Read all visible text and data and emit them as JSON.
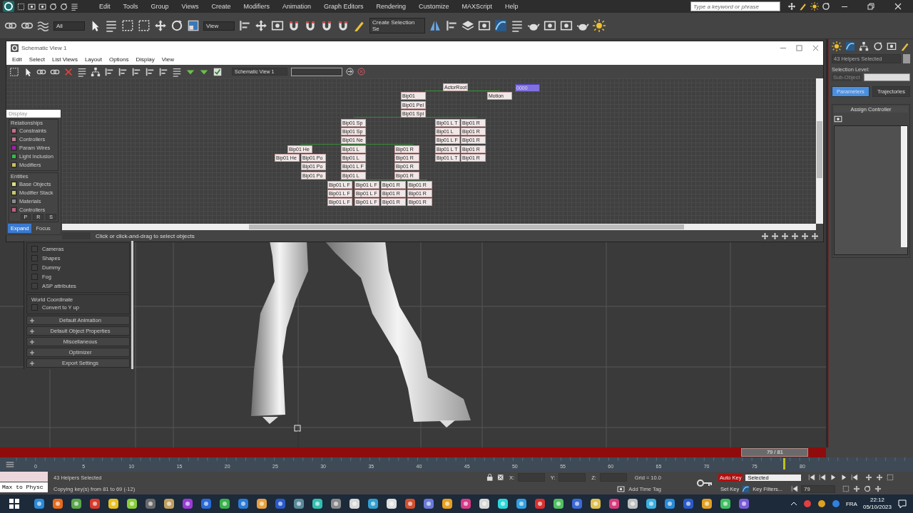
{
  "menu": [
    "Edit",
    "Tools",
    "Group",
    "Views",
    "Create",
    "Modifiers",
    "Animation",
    "Graph Editors",
    "Rendering",
    "Customize",
    "MAXScript",
    "Help"
  ],
  "search": {
    "placeholder": "Type a keyword or phrase"
  },
  "toolbar": {
    "selection_filter": "All",
    "reference_coord": "View",
    "named_selection": "Create Selection Se"
  },
  "schematic": {
    "title": "Schematic View 1",
    "menu": [
      "Edit",
      "Select",
      "List Views",
      "Layout",
      "Options",
      "Display",
      "View"
    ],
    "view_name": "Schematic View 1",
    "status": "Click or click-and-drag to select objects",
    "nodes": [
      {
        "label": "ActorRoot",
        "selected": false
      },
      {
        "label": "0000",
        "selected": true
      },
      {
        "label": "Bip01",
        "selected": false
      },
      {
        "label": "Motion",
        "selected": false
      },
      {
        "label": "Bip01 Pel",
        "selected": false
      },
      {
        "label": "Bip01 Spi",
        "selected": false
      },
      {
        "label": "Bip01 Sp",
        "selected": false
      },
      {
        "label": "Bip01 L T",
        "selected": false
      },
      {
        "label": "Bip01 R",
        "selected": false
      },
      {
        "label": "Bip01 Sp",
        "selected": false
      },
      {
        "label": "Bip01 L",
        "selected": false
      },
      {
        "label": "Bip01 R",
        "selected": false
      },
      {
        "label": "Bip01 Ne",
        "selected": false
      },
      {
        "label": "Bip01 L F",
        "selected": false
      },
      {
        "label": "Bip01 R",
        "selected": false
      },
      {
        "label": "Bip01 He",
        "selected": false
      },
      {
        "label": "Bip01 L",
        "selected": false
      },
      {
        "label": "Bip01 R",
        "selected": false
      },
      {
        "label": "Bip01 L T",
        "selected": false
      },
      {
        "label": "Bip01 R",
        "selected": false
      },
      {
        "label": "Bip01 He",
        "selected": false
      },
      {
        "label": "Bip01 Po",
        "selected": false
      },
      {
        "label": "Bip01 L",
        "selected": false
      },
      {
        "label": "Bip01 R",
        "selected": false
      },
      {
        "label": "Bip01 L T",
        "selected": false
      },
      {
        "label": "Bip01 R",
        "selected": false
      },
      {
        "label": "Bip01 Po",
        "selected": false
      },
      {
        "label": "Bip01 L F",
        "selected": false
      },
      {
        "label": "Bip01 R",
        "selected": false
      },
      {
        "label": "Bip01 Po",
        "selected": false
      },
      {
        "label": "Bip01 L",
        "selected": false
      },
      {
        "label": "Bip01 R",
        "selected": false
      },
      {
        "label": "Bip01 L F",
        "selected": false
      },
      {
        "label": "Bip01 L F",
        "selected": false
      },
      {
        "label": "Bip01 R",
        "selected": false
      },
      {
        "label": "Bip01 R",
        "selected": false
      },
      {
        "label": "Bip01 L F",
        "selected": false
      },
      {
        "label": "Bip01 L F",
        "selected": false
      },
      {
        "label": "Bip01 R",
        "selected": false
      },
      {
        "label": "Bip01 R",
        "selected": false
      },
      {
        "label": "Bip01 L F",
        "selected": false
      },
      {
        "label": "Bip01 L F",
        "selected": false
      },
      {
        "label": "Bip01 R",
        "selected": false
      },
      {
        "label": "Bip01 R",
        "selected": false
      }
    ]
  },
  "display_panel": {
    "title": "Display",
    "relationships_title": "Relationships",
    "relationships": [
      {
        "label": "Constraints",
        "color": "#d06a8a"
      },
      {
        "label": "Controllers",
        "color": "#c07a94"
      },
      {
        "label": "Param Wires",
        "color": "#a020a8"
      },
      {
        "label": "Light Inclusion",
        "color": "#30c040"
      },
      {
        "label": "Modifiers",
        "color": "#c8c060"
      }
    ],
    "entities_title": "Entities",
    "entities": [
      {
        "label": "Base Objects",
        "color": "#e0e080"
      },
      {
        "label": "Modifier Stack",
        "color": "#c8c868"
      },
      {
        "label": "Materials",
        "color": "#8c8c8c"
      },
      {
        "label": "Controllers",
        "color": "#c06080"
      }
    ],
    "prs": [
      "P",
      "R",
      "S"
    ],
    "tabs": [
      {
        "label": "Expand",
        "selected": true
      },
      {
        "label": "Focus",
        "selected": false
      }
    ]
  },
  "export_panel": {
    "options": [
      {
        "label": "Cameras",
        "checked": false
      },
      {
        "label": "Shapes",
        "checked": false
      },
      {
        "label": "Dummy",
        "checked": false
      },
      {
        "label": "Fog",
        "checked": false
      },
      {
        "label": "ASP attributes",
        "checked": false
      }
    ],
    "world_coordinate": {
      "title": "World Coordinate",
      "options": [
        {
          "label": "Convert to Y up",
          "checked": false
        }
      ]
    },
    "rollouts": [
      "Default Animation",
      "Default Object Properties",
      "Miscellaneous",
      "Optimizer",
      "Export Settings"
    ]
  },
  "command_panel": {
    "object_name": "43 Helpers Selected",
    "selection_level": "Selection Level:",
    "sub_object": "Sub-Object",
    "buttons": [
      {
        "label": "Parameters",
        "selected": true
      },
      {
        "label": "Trajectories",
        "selected": false
      }
    ],
    "rollout": "Assign Controller"
  },
  "time_slider": {
    "label": "79 / 81",
    "level": 0.975
  },
  "track_bar": {
    "ticks": [
      "0",
      "5",
      "10",
      "15",
      "20",
      "25",
      "30",
      "35",
      "40",
      "45",
      "50",
      "55",
      "60",
      "65",
      "70",
      "75",
      "80"
    ]
  },
  "status": {
    "listener": "Max to Physc",
    "selection": "43 Helpers Selected",
    "prompt": "Copying key(s) from 81 to 69 (-12)",
    "x_label": "X:",
    "y_label": "Y:",
    "z_label": "Z:",
    "grid": "Grid = 10.0",
    "add_time_tag": "Add Time Tag",
    "auto_key": "Auto Key",
    "key_mode": "Selected",
    "set_key": "Set Key",
    "key_filters": "Key Filters...",
    "frame": "79"
  },
  "taskbar": {
    "language": "FRA",
    "time": "22:12",
    "date": "05/10/2023"
  }
}
